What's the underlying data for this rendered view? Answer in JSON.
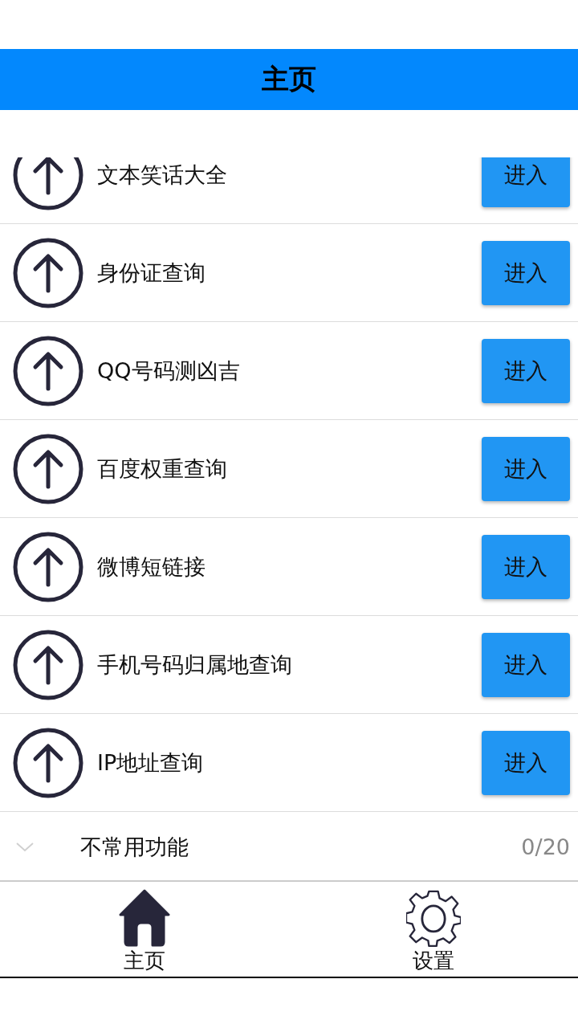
{
  "header": {
    "title": "主页"
  },
  "items": [
    {
      "label": "文本笑话大全",
      "button": "进入"
    },
    {
      "label": "身份证查询",
      "button": "进入"
    },
    {
      "label": "QQ号码测凶吉",
      "button": "进入"
    },
    {
      "label": "百度权重查询",
      "button": "进入"
    },
    {
      "label": "微博短链接",
      "button": "进入"
    },
    {
      "label": "手机号码归属地查询",
      "button": "进入"
    },
    {
      "label": "IP地址查询",
      "button": "进入"
    }
  ],
  "group": {
    "label": "不常用功能",
    "count": "0/20",
    "expanded": false
  },
  "tab_bar": [
    {
      "kind": "home",
      "label": "主页"
    },
    {
      "kind": "settings",
      "label": "设置"
    }
  ]
}
